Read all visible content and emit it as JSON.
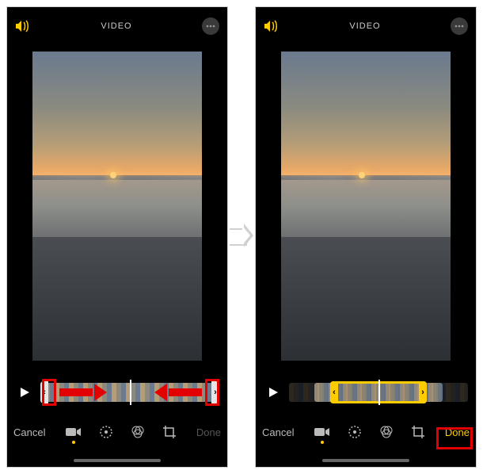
{
  "left_panel": {
    "title": "VIDEO",
    "volume_icon": "volume-icon",
    "more_icon": "more-icon",
    "play_icon": "play-icon",
    "timeline": {
      "left_handle": "‹",
      "right_handle": "›"
    },
    "toolbar": {
      "cancel": "Cancel",
      "done": "Done",
      "icons": [
        "video-icon",
        "adjust-icon",
        "filters-icon",
        "crop-icon"
      ]
    }
  },
  "right_panel": {
    "title": "VIDEO",
    "volume_icon": "volume-icon",
    "more_icon": "more-icon",
    "play_icon": "play-icon",
    "timeline": {
      "left_handle": "‹",
      "right_handle": "›"
    },
    "toolbar": {
      "cancel": "Cancel",
      "done": "Done",
      "icons": [
        "video-icon",
        "adjust-icon",
        "filters-icon",
        "crop-icon"
      ]
    }
  },
  "annotations": {
    "left_handle_highlight": true,
    "right_handle_highlight": true,
    "drag_arrows": true,
    "done_highlight": true
  },
  "colors": {
    "accent": "#ffcc00",
    "highlight": "#e20000"
  }
}
